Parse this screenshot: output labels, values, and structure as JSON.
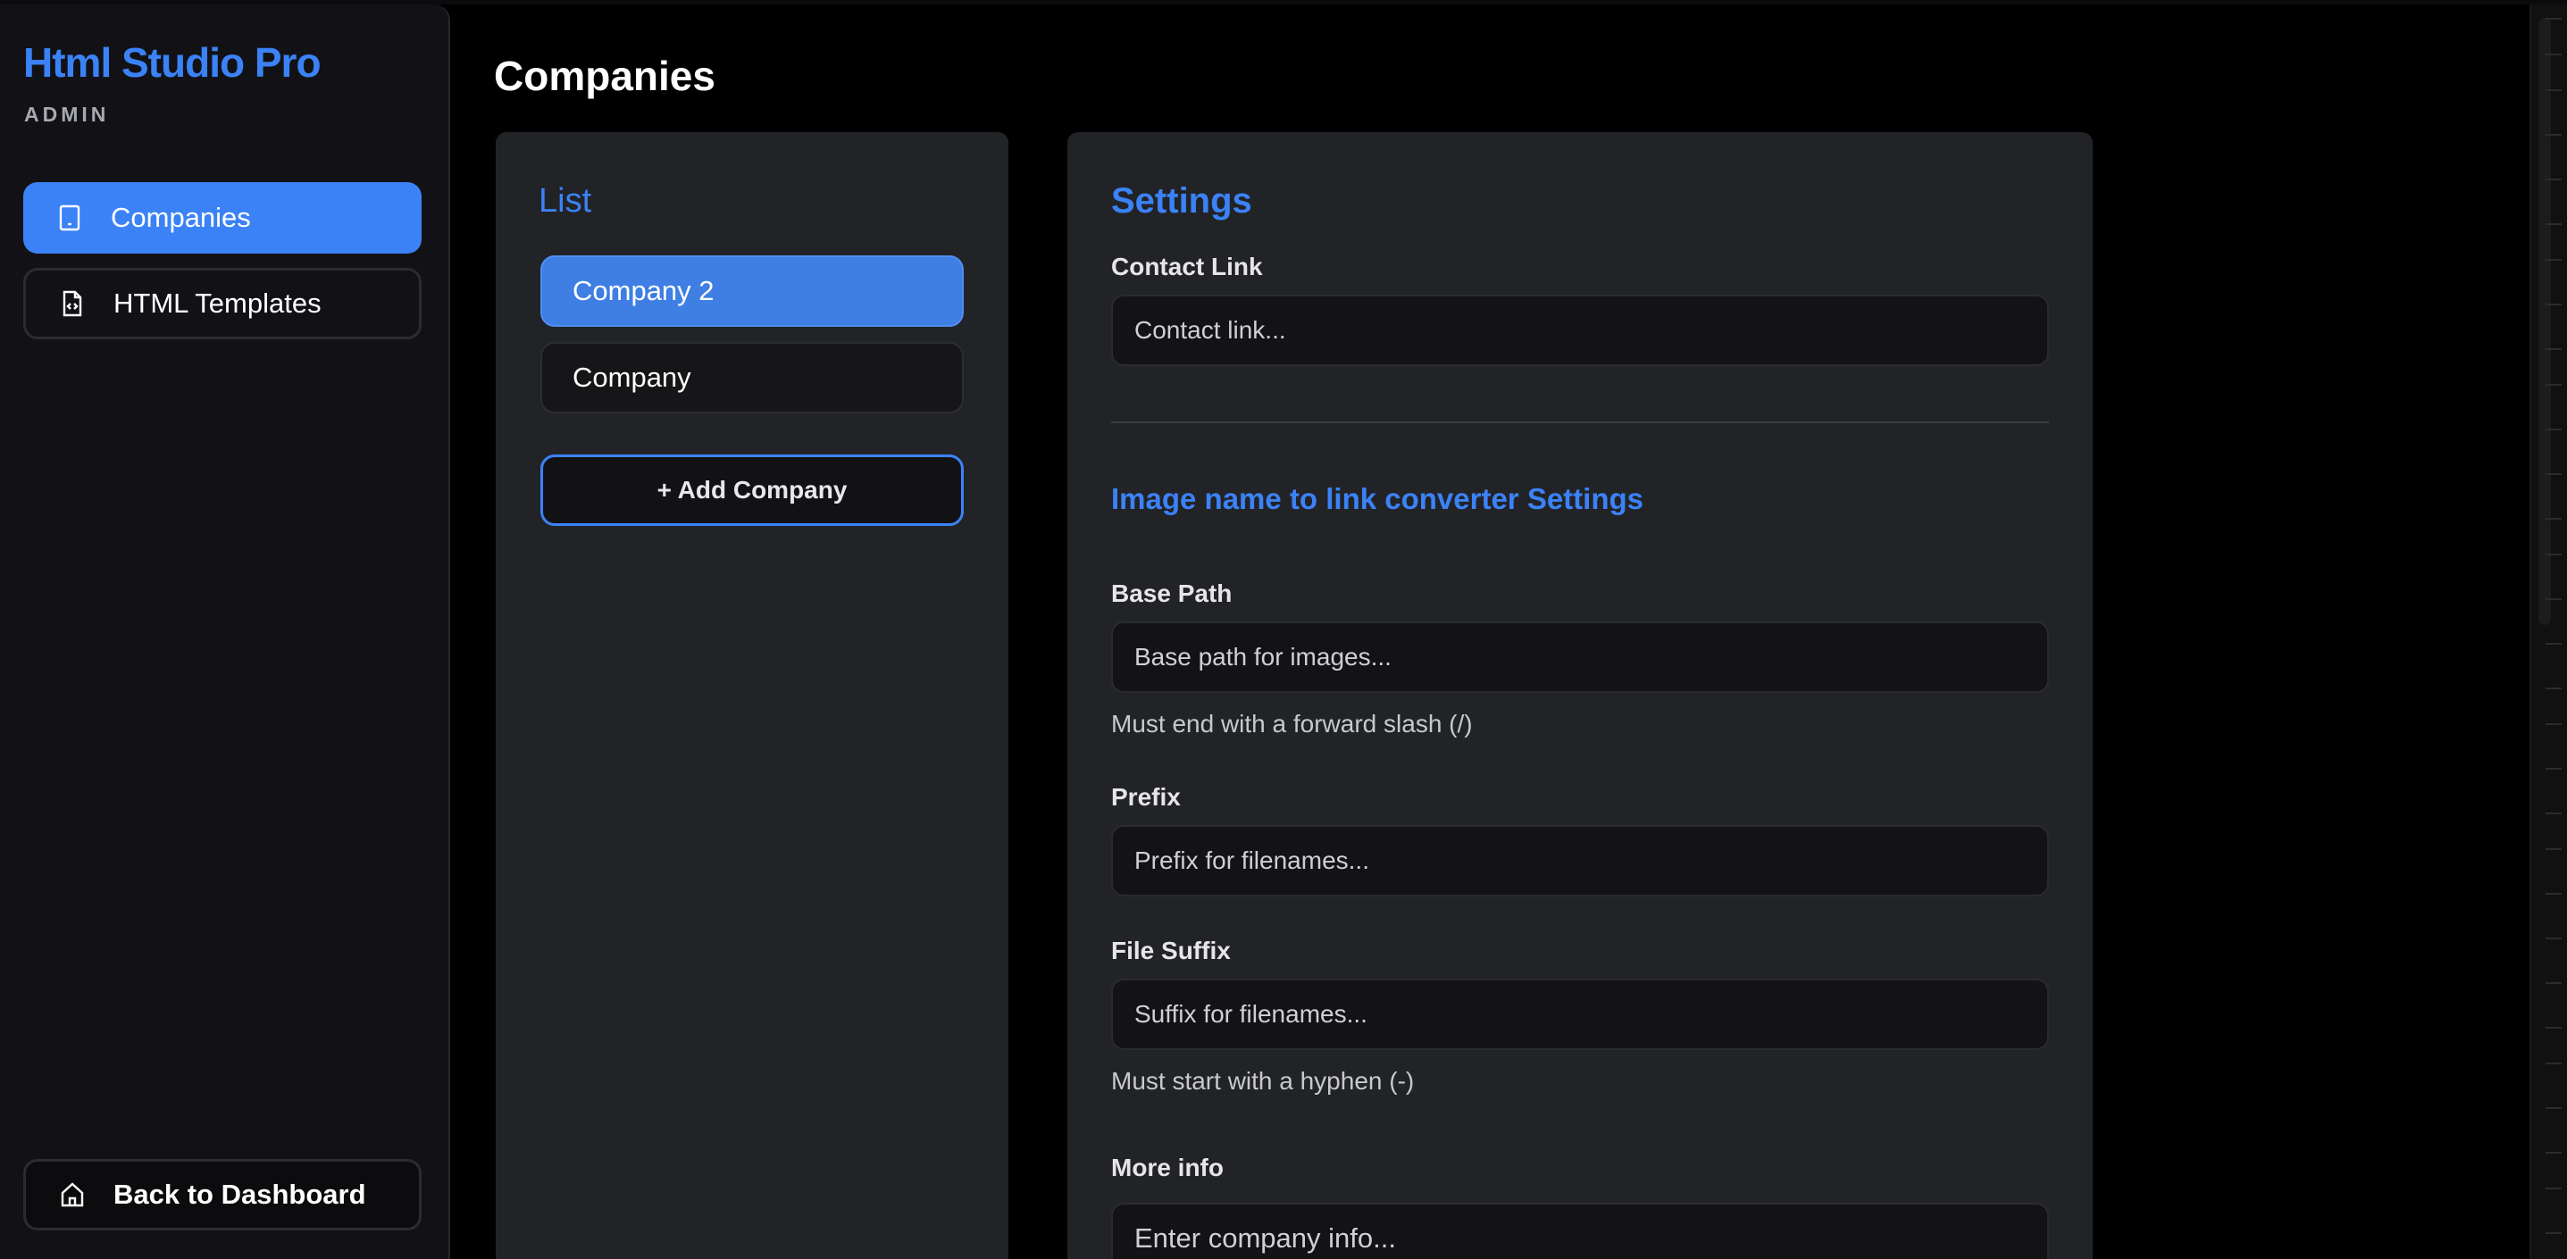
{
  "app": {
    "brand": "Html Studio Pro",
    "role": "ADMIN",
    "accent": "#3b82f6"
  },
  "sidebar": {
    "items": [
      {
        "label": "Companies",
        "icon": "building-icon",
        "active": true
      },
      {
        "label": "HTML Templates",
        "icon": "file-code-icon",
        "active": false
      }
    ],
    "back": {
      "label": "Back to Dashboard",
      "icon": "home-icon"
    }
  },
  "page": {
    "title": "Companies"
  },
  "list": {
    "heading": "List",
    "companies": [
      {
        "name": "Company 2",
        "selected": true
      },
      {
        "name": "Company",
        "selected": false
      }
    ],
    "add_label": "+ Add Company"
  },
  "settings": {
    "heading": "Settings",
    "contact_link": {
      "label": "Contact Link",
      "placeholder": "Contact link...",
      "value": ""
    },
    "converter": {
      "heading": "Image name to link converter Settings",
      "base_path": {
        "label": "Base Path",
        "placeholder": "Base path for images...",
        "value": "",
        "hint": "Must end with a forward slash (/)"
      },
      "prefix": {
        "label": "Prefix",
        "placeholder": "Prefix for filenames...",
        "value": ""
      },
      "file_suffix": {
        "label": "File Suffix",
        "placeholder": "Suffix for filenames...",
        "value": "",
        "hint": "Must start with a hyphen (-)"
      }
    },
    "more_info": {
      "label": "More info",
      "placeholder": "Enter company info...",
      "value": ""
    }
  }
}
